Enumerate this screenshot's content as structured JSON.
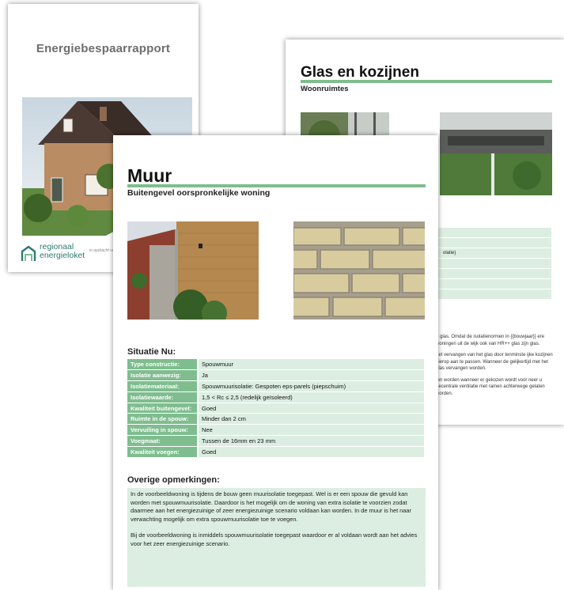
{
  "cover": {
    "title": "Energiebespaarrapport",
    "logo_line1": "regionaal",
    "logo_line2": "energieloket",
    "tagline": "in opdracht van"
  },
  "glass_page": {
    "title": "Glas en kozijnen",
    "subtitle": "Woonruimtes",
    "table_fragment": "olatie)",
    "notes": [
      "o glas. Omdat de isolatienormen in {{bouwjaar}} ere woningen uit de wijk ook van HR++ glas zijn glas.",
      "het vervangen van het glas door tenminste ijke kozijnen hierop aan te passen. Wanneer de gelijkertijd met het glas vervangen worden.",
      "ten worden wanneer er gekozen wordt voor neer u decentrale ventilatie met ramen achterwege gelaten worden."
    ]
  },
  "wall_page": {
    "title": "Muur",
    "subtitle": "Buitengevel oorspronkelijke woning",
    "situation_title": "Situatie Nu:",
    "situation": [
      {
        "label": "Type constructie:",
        "value": "Spouwmuur"
      },
      {
        "label": "Isolatie aanwezig:",
        "value": "Ja"
      },
      {
        "label": "Isolatiemateriaal:",
        "value": "Spouwmuurisolatie: Gespoten eps-parels (piepschuim)"
      },
      {
        "label": "Isolatiewaarde:",
        "value": "1,5 < Rc ≤ 2,5 (redelijk geïsoleerd)"
      },
      {
        "label": "Kwaliteit buitengevel:",
        "value": "Goed"
      },
      {
        "label": "Ruimte in de spouw:",
        "value": "Minder dan 2 cm"
      },
      {
        "label": "Vervuiling in spouw:",
        "value": "Nee"
      },
      {
        "label": "Voegmaat:",
        "value": "Tussen de 16mm en 23 mm"
      },
      {
        "label": "Kwaliteit voegen:",
        "value": "Goed"
      }
    ],
    "remarks_title": "Overige opmerkingen:",
    "remarks_p1": "In de voorbeeldwoning is tijdens de bouw geen muurisolatie toegepast. Wel is er een spouw die gevuld kan worden met spouwmuurisolatie. Daardoor is het mogelijk om de woning van extra isolatie te voorzien zodat daarmee aan het energiezuinige of zeer energiezuinige scenario voldaan kan worden. In de muur is het naar verwachting mogelijk om extra spouwmuurisolatie toe te voegen.",
    "remarks_p2": "Bij de voorbeeldwoning is inmiddels spouwmuurisolatie toegepast waardoor er al voldaan wordt aan het advies voor het zeer energiezuinige scenario."
  },
  "colors": {
    "accent_green": "#7fbd8f",
    "light_green": "#dceee1",
    "logo_teal": "#2e7a73"
  }
}
